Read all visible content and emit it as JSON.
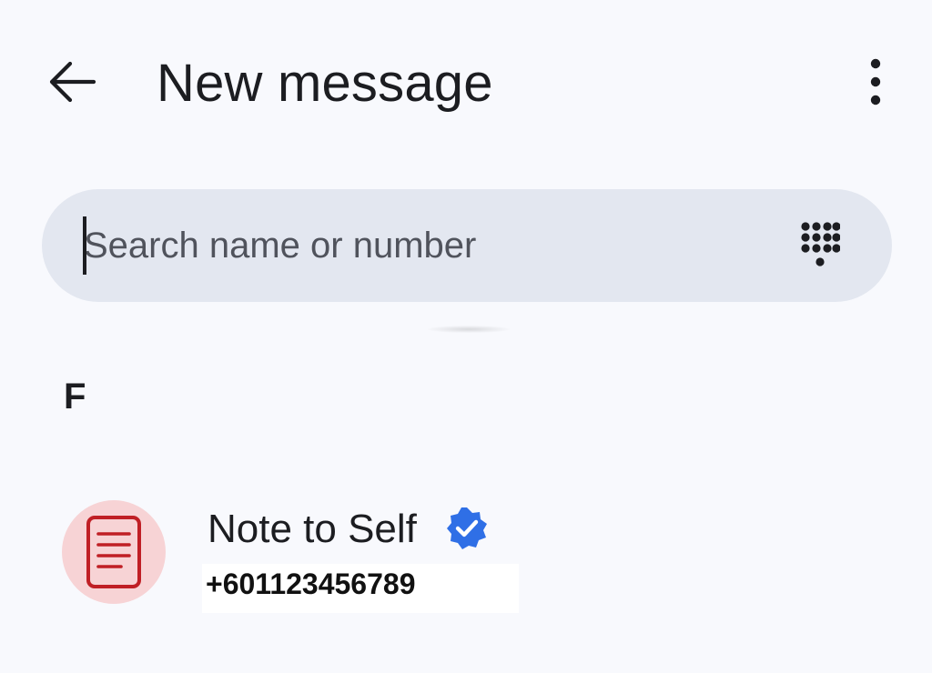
{
  "header": {
    "title": "New message",
    "back_icon": "arrow-left-icon",
    "more_icon": "more-vert-icon"
  },
  "search": {
    "placeholder": "Search name or number",
    "value": "",
    "dialpad_icon": "dialpad-icon"
  },
  "contacts": {
    "sections": [
      {
        "letter": "F",
        "items": [
          {
            "name": "Note to Self",
            "number": "+601123456789",
            "avatar_icon": "note-document-icon",
            "verified_icon": "verified-badge-icon",
            "avatar_bg": "#f7d3d5",
            "avatar_fg": "#c01f25",
            "badge_color": "#2f6fe6"
          }
        ]
      }
    ]
  },
  "colors": {
    "background": "#f8f9fd",
    "search_bg": "#e3e7f0",
    "text_primary": "#1c1d21",
    "placeholder": "#50535c"
  }
}
